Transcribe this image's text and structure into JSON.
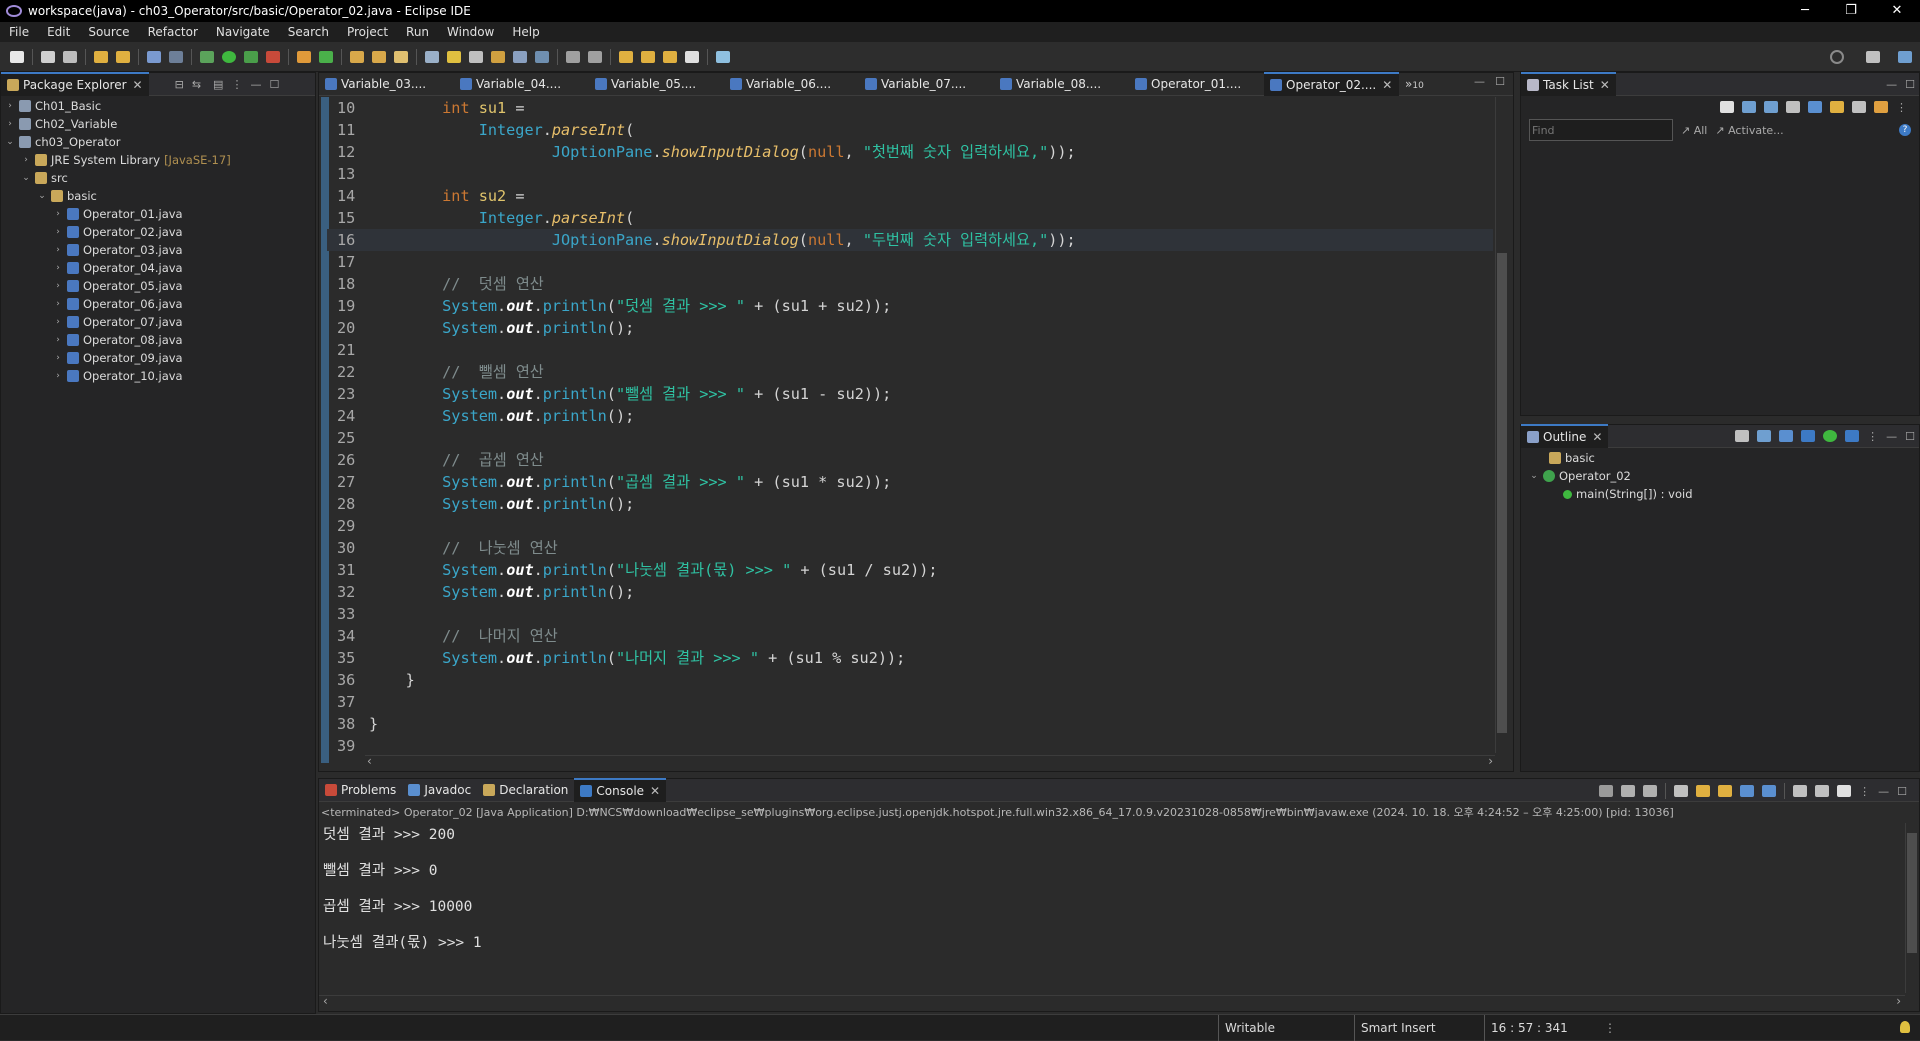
{
  "window": {
    "title": "workspace(java) - ch03_Operator/src/basic/Operator_02.java - Eclipse IDE",
    "min": "─",
    "restore": "❐",
    "close": "✕"
  },
  "menu": [
    "File",
    "Edit",
    "Source",
    "Refactor",
    "Navigate",
    "Search",
    "Project",
    "Run",
    "Window",
    "Help"
  ],
  "package_explorer": {
    "title": "Package Explorer",
    "items": [
      {
        "label": "Ch01_Basic",
        "chev": "›",
        "depth": 0,
        "icon": "project-icon"
      },
      {
        "label": "Ch02_Variable",
        "chev": "›",
        "depth": 0,
        "icon": "project-icon"
      },
      {
        "label": "ch03_Operator",
        "chev": "⌄",
        "depth": 0,
        "icon": "project-icon"
      },
      {
        "label": "JRE System Library",
        "extra": "[JavaSE-17]",
        "chev": "›",
        "depth": 1,
        "icon": "library-icon"
      },
      {
        "label": "src",
        "chev": "⌄",
        "depth": 1,
        "icon": "source-folder-icon"
      },
      {
        "label": "basic",
        "chev": "⌄",
        "depth": 2,
        "icon": "package-icon"
      },
      {
        "label": "Operator_01.java",
        "chev": "›",
        "depth": 3,
        "icon": "java-file-icon"
      },
      {
        "label": "Operator_02.java",
        "chev": "›",
        "depth": 3,
        "icon": "java-file-icon"
      },
      {
        "label": "Operator_03.java",
        "chev": "›",
        "depth": 3,
        "icon": "java-file-icon"
      },
      {
        "label": "Operator_04.java",
        "chev": "›",
        "depth": 3,
        "icon": "java-file-icon"
      },
      {
        "label": "Operator_05.java",
        "chev": "›",
        "depth": 3,
        "icon": "java-file-icon"
      },
      {
        "label": "Operator_06.java",
        "chev": "›",
        "depth": 3,
        "icon": "java-file-icon"
      },
      {
        "label": "Operator_07.java",
        "chev": "›",
        "depth": 3,
        "icon": "java-file-icon"
      },
      {
        "label": "Operator_08.java",
        "chev": "›",
        "depth": 3,
        "icon": "java-file-icon"
      },
      {
        "label": "Operator_09.java",
        "chev": "›",
        "depth": 3,
        "icon": "java-file-icon"
      },
      {
        "label": "Operator_10.java",
        "chev": "›",
        "depth": 3,
        "icon": "java-file-icon"
      }
    ]
  },
  "editor": {
    "tabs": [
      "Variable_03....",
      "Variable_04....",
      "Variable_05....",
      "Variable_06....",
      "Variable_07....",
      "Variable_08....",
      "Operator_01....",
      "Operator_02...."
    ],
    "active_tab": 7,
    "overflow": "»",
    "overflow_count": "10",
    "cursor_line": 16,
    "lines": [
      {
        "n": "10",
        "tokens": [
          [
            "pl",
            "        "
          ],
          [
            "kw",
            "int"
          ],
          [
            "pl",
            " "
          ],
          [
            "var",
            "su1"
          ],
          [
            "pl",
            " ="
          ]
        ]
      },
      {
        "n": "11",
        "tokens": [
          [
            "pl",
            "            "
          ],
          [
            "cls",
            "Integer"
          ],
          [
            "pl",
            "."
          ],
          [
            "mth",
            "parseInt"
          ],
          [
            "pl",
            "("
          ]
        ]
      },
      {
        "n": "12",
        "tokens": [
          [
            "pl",
            "                    "
          ],
          [
            "cls",
            "JOptionPane"
          ],
          [
            "pl",
            "."
          ],
          [
            "mth",
            "showInputDialog"
          ],
          [
            "pl",
            "("
          ],
          [
            "kw",
            "null"
          ],
          [
            "pl",
            ", "
          ],
          [
            "str2",
            "\"첫번째 숫자 입력하세요,\""
          ],
          [
            "pl",
            "));"
          ]
        ]
      },
      {
        "n": "13",
        "tokens": []
      },
      {
        "n": "14",
        "tokens": [
          [
            "pl",
            "        "
          ],
          [
            "kw",
            "int"
          ],
          [
            "pl",
            " "
          ],
          [
            "var",
            "su2"
          ],
          [
            "pl",
            " ="
          ]
        ]
      },
      {
        "n": "15",
        "tokens": [
          [
            "pl",
            "            "
          ],
          [
            "cls",
            "Integer"
          ],
          [
            "pl",
            "."
          ],
          [
            "mth",
            "parseInt"
          ],
          [
            "pl",
            "("
          ]
        ]
      },
      {
        "n": "16",
        "tokens": [
          [
            "pl",
            "                    "
          ],
          [
            "cls",
            "JOptionPane"
          ],
          [
            "pl",
            "."
          ],
          [
            "mth",
            "showInputDialog"
          ],
          [
            "pl",
            "("
          ],
          [
            "kw",
            "null"
          ],
          [
            "pl",
            ", "
          ],
          [
            "str2",
            "\"두번째 숫자 입력하세요,\""
          ],
          [
            "pl",
            "));"
          ]
        ]
      },
      {
        "n": "17",
        "tokens": []
      },
      {
        "n": "18",
        "tokens": [
          [
            "pl",
            "        "
          ],
          [
            "cmt",
            "//  덧셈 연산"
          ]
        ]
      },
      {
        "n": "19",
        "tokens": [
          [
            "pl",
            "        "
          ],
          [
            "cls",
            "System"
          ],
          [
            "pl",
            "."
          ],
          [
            "fld",
            "out"
          ],
          [
            "pl",
            "."
          ],
          [
            "cls",
            "println"
          ],
          [
            "pl",
            "("
          ],
          [
            "str2",
            "\"덧셈 결과 >>> \""
          ],
          [
            "pl",
            " + (su1 + su2));"
          ]
        ]
      },
      {
        "n": "20",
        "tokens": [
          [
            "pl",
            "        "
          ],
          [
            "cls",
            "System"
          ],
          [
            "pl",
            "."
          ],
          [
            "fld",
            "out"
          ],
          [
            "pl",
            "."
          ],
          [
            "cls",
            "println"
          ],
          [
            "pl",
            "();"
          ]
        ]
      },
      {
        "n": "21",
        "tokens": []
      },
      {
        "n": "22",
        "tokens": [
          [
            "pl",
            "        "
          ],
          [
            "cmt",
            "//  뺄셈 연산"
          ]
        ]
      },
      {
        "n": "23",
        "tokens": [
          [
            "pl",
            "        "
          ],
          [
            "cls",
            "System"
          ],
          [
            "pl",
            "."
          ],
          [
            "fld",
            "out"
          ],
          [
            "pl",
            "."
          ],
          [
            "cls",
            "println"
          ],
          [
            "pl",
            "("
          ],
          [
            "str2",
            "\"뺄셈 결과 >>> \""
          ],
          [
            "pl",
            " + (su1 - su2));"
          ]
        ]
      },
      {
        "n": "24",
        "tokens": [
          [
            "pl",
            "        "
          ],
          [
            "cls",
            "System"
          ],
          [
            "pl",
            "."
          ],
          [
            "fld",
            "out"
          ],
          [
            "pl",
            "."
          ],
          [
            "cls",
            "println"
          ],
          [
            "pl",
            "();"
          ]
        ]
      },
      {
        "n": "25",
        "tokens": []
      },
      {
        "n": "26",
        "tokens": [
          [
            "pl",
            "        "
          ],
          [
            "cmt",
            "//  곱셈 연산"
          ]
        ]
      },
      {
        "n": "27",
        "tokens": [
          [
            "pl",
            "        "
          ],
          [
            "cls",
            "System"
          ],
          [
            "pl",
            "."
          ],
          [
            "fld",
            "out"
          ],
          [
            "pl",
            "."
          ],
          [
            "cls",
            "println"
          ],
          [
            "pl",
            "("
          ],
          [
            "str2",
            "\"곱셈 결과 >>> \""
          ],
          [
            "pl",
            " + (su1 * su2));"
          ]
        ]
      },
      {
        "n": "28",
        "tokens": [
          [
            "pl",
            "        "
          ],
          [
            "cls",
            "System"
          ],
          [
            "pl",
            "."
          ],
          [
            "fld",
            "out"
          ],
          [
            "pl",
            "."
          ],
          [
            "cls",
            "println"
          ],
          [
            "pl",
            "();"
          ]
        ]
      },
      {
        "n": "29",
        "tokens": []
      },
      {
        "n": "30",
        "tokens": [
          [
            "pl",
            "        "
          ],
          [
            "cmt",
            "//  나눗셈 연산"
          ]
        ]
      },
      {
        "n": "31",
        "tokens": [
          [
            "pl",
            "        "
          ],
          [
            "cls",
            "System"
          ],
          [
            "pl",
            "."
          ],
          [
            "fld",
            "out"
          ],
          [
            "pl",
            "."
          ],
          [
            "cls",
            "println"
          ],
          [
            "pl",
            "("
          ],
          [
            "str2",
            "\"나눗셈 결과(몫) >>> \""
          ],
          [
            "pl",
            " + (su1 / su2));"
          ]
        ]
      },
      {
        "n": "32",
        "tokens": [
          [
            "pl",
            "        "
          ],
          [
            "cls",
            "System"
          ],
          [
            "pl",
            "."
          ],
          [
            "fld",
            "out"
          ],
          [
            "pl",
            "."
          ],
          [
            "cls",
            "println"
          ],
          [
            "pl",
            "();"
          ]
        ]
      },
      {
        "n": "33",
        "tokens": []
      },
      {
        "n": "34",
        "tokens": [
          [
            "pl",
            "        "
          ],
          [
            "cmt",
            "//  나머지 연산"
          ]
        ]
      },
      {
        "n": "35",
        "tokens": [
          [
            "pl",
            "        "
          ],
          [
            "cls",
            "System"
          ],
          [
            "pl",
            "."
          ],
          [
            "fld",
            "out"
          ],
          [
            "pl",
            "."
          ],
          [
            "cls",
            "println"
          ],
          [
            "pl",
            "("
          ],
          [
            "str2",
            "\"나머지 결과 >>> \""
          ],
          [
            "pl",
            " + (su1 % su2));"
          ]
        ]
      },
      {
        "n": "36",
        "tokens": [
          [
            "pl",
            "    }"
          ]
        ]
      },
      {
        "n": "37",
        "tokens": []
      },
      {
        "n": "38",
        "tokens": [
          [
            "pl",
            "}"
          ]
        ]
      },
      {
        "n": "39",
        "tokens": []
      }
    ]
  },
  "task_list": {
    "title": "Task List",
    "find_placeholder": "Find",
    "all": "All",
    "activate": "Activate..."
  },
  "outline": {
    "title": "Outline",
    "package": "basic",
    "class": "Operator_02",
    "method": "main(String[]) : void"
  },
  "bottom": {
    "tabs": [
      "Problems",
      "Javadoc",
      "Declaration",
      "Console"
    ],
    "active_tab": 3,
    "terminated": "<terminated> Operator_02 [Java Application] D:₩NCS₩download₩eclipse_se₩plugins₩org.eclipse.justj.openjdk.hotspot.jre.full.win32.x86_64_17.0.9.v20231028-0858₩jre₩bin₩javaw.exe  (2024. 10. 18. 오후 4:24:52 – 오후 4:25:00) [pid: 13036]",
    "output": [
      "덧셈 결과 >>> 200",
      "",
      "뺄셈 결과 >>> 0",
      "",
      "곱셈 결과 >>> 10000",
      "",
      "나눗셈 결과(몫) >>> 1"
    ]
  },
  "status": {
    "writable": "Writable",
    "insert_mode": "Smart Insert",
    "position": "16 : 57 : 341"
  }
}
